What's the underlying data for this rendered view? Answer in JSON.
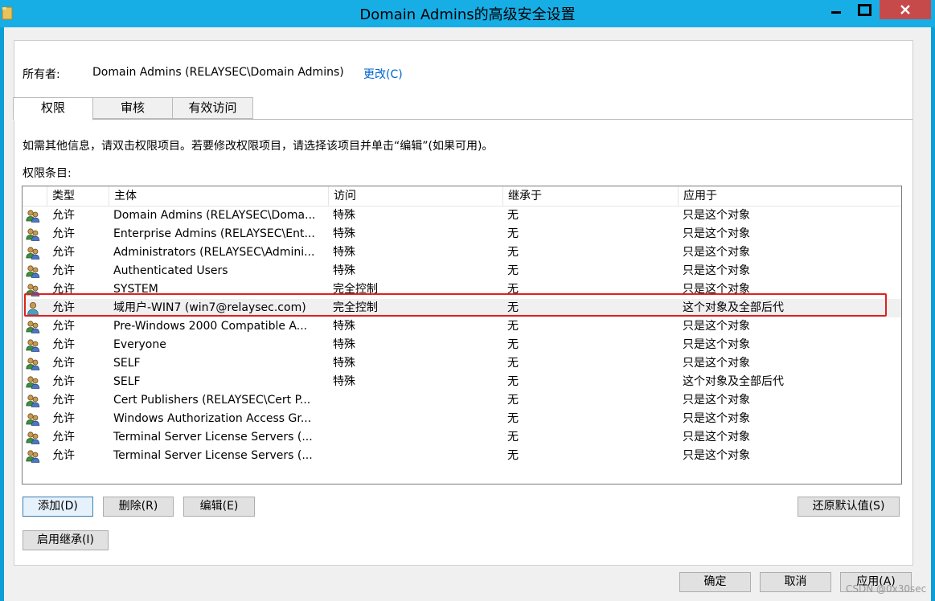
{
  "window": {
    "title": "Domain Admins的高级安全设置",
    "controls": [
      "minimize-icon",
      "maximize-icon",
      "close-icon"
    ]
  },
  "owner": {
    "label": "所有者:",
    "value": "Domain Admins (RELAYSEC\\Domain Admins)",
    "change_link": "更改(C)"
  },
  "tabs": [
    {
      "label": "权限",
      "active": true
    },
    {
      "label": "审核",
      "active": false
    },
    {
      "label": "有效访问",
      "active": false
    }
  ],
  "hint": "如需其他信息，请双击权限项目。若要修改权限项目，请选择该项目并单击“编辑”(如果可用)。",
  "entries_label": "权限条目:",
  "table": {
    "columns": [
      "类型",
      "主体",
      "访问",
      "继承于",
      "应用于"
    ],
    "rows": [
      {
        "icon": "group-users-icon",
        "type": "允许",
        "principal": "Domain Admins (RELAYSEC\\Doma...",
        "access": "特殊",
        "inherited": "无",
        "applies": "只是这个对象"
      },
      {
        "icon": "group-users-icon",
        "type": "允许",
        "principal": "Enterprise Admins (RELAYSEC\\Ent...",
        "access": "特殊",
        "inherited": "无",
        "applies": "只是这个对象"
      },
      {
        "icon": "group-users-icon",
        "type": "允许",
        "principal": "Administrators (RELAYSEC\\Admini...",
        "access": "特殊",
        "inherited": "无",
        "applies": "只是这个对象"
      },
      {
        "icon": "group-users-icon",
        "type": "允许",
        "principal": "Authenticated Users",
        "access": "特殊",
        "inherited": "无",
        "applies": "只是这个对象"
      },
      {
        "icon": "group-users-icon",
        "type": "允许",
        "principal": "SYSTEM",
        "access": "完全控制",
        "inherited": "无",
        "applies": "只是这个对象"
      },
      {
        "icon": "single-user-icon",
        "type": "允许",
        "principal": "域用户-WIN7 (win7@relaysec.com)",
        "access": "完全控制",
        "inherited": "无",
        "applies": "这个对象及全部后代"
      },
      {
        "icon": "group-users-icon",
        "type": "允许",
        "principal": "Pre-Windows 2000 Compatible A...",
        "access": "特殊",
        "inherited": "无",
        "applies": "只是这个对象"
      },
      {
        "icon": "group-users-icon",
        "type": "允许",
        "principal": "Everyone",
        "access": "特殊",
        "inherited": "无",
        "applies": "只是这个对象"
      },
      {
        "icon": "group-users-icon",
        "type": "允许",
        "principal": "SELF",
        "access": "特殊",
        "inherited": "无",
        "applies": "只是这个对象"
      },
      {
        "icon": "group-users-icon",
        "type": "允许",
        "principal": "SELF",
        "access": "特殊",
        "inherited": "无",
        "applies": "这个对象及全部后代"
      },
      {
        "icon": "group-users-icon",
        "type": "允许",
        "principal": "Cert Publishers (RELAYSEC\\Cert P...",
        "access": "",
        "inherited": "无",
        "applies": "只是这个对象"
      },
      {
        "icon": "group-users-icon",
        "type": "允许",
        "principal": "Windows Authorization Access Gr...",
        "access": "",
        "inherited": "无",
        "applies": "只是这个对象"
      },
      {
        "icon": "group-users-icon",
        "type": "允许",
        "principal": "Terminal Server License Servers (...",
        "access": "",
        "inherited": "无",
        "applies": "只是这个对象"
      },
      {
        "icon": "group-users-icon",
        "type": "允许",
        "principal": "Terminal Server License Servers (...",
        "access": "",
        "inherited": "无",
        "applies": "只是这个对象"
      }
    ],
    "selected_row": 5
  },
  "buttons": {
    "add": "添加(D)",
    "remove": "删除(R)",
    "edit": "编辑(E)",
    "restore_defaults": "还原默认值(S)",
    "enable_inheritance": "启用继承(I)",
    "ok": "确定",
    "cancel": "取消",
    "apply": "应用(A)"
  },
  "watermark": "CSDN @0x30sec",
  "colors": {
    "titlebar": "#17aee6",
    "close_button": "#c74a4a",
    "link": "#0066cc",
    "highlight": "#e02020"
  }
}
